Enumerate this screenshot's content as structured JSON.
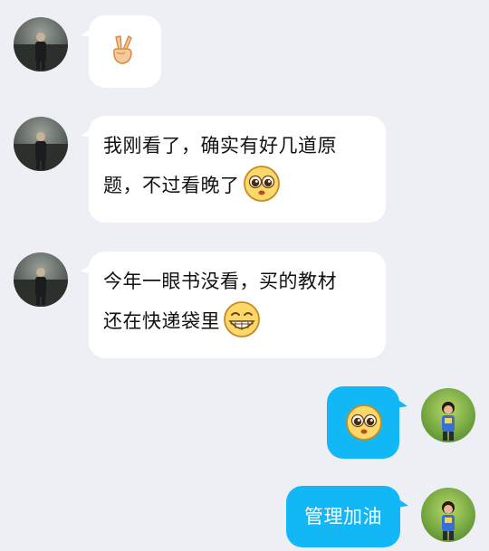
{
  "conversation": {
    "messages": [
      {
        "side": "left",
        "type": "emoji",
        "emoji": "victory-hand-icon"
      },
      {
        "side": "left",
        "type": "text",
        "line1": "我刚看了，确实有好几道原",
        "line2": "题，不过看晚了",
        "emoji": "pleading-face-icon"
      },
      {
        "side": "left",
        "type": "text",
        "line1": "今年一眼书没看，买的教材",
        "line2": "还在快递袋里",
        "emoji": "grinning-face-icon"
      },
      {
        "side": "right",
        "type": "emoji",
        "emoji": "pleading-face-icon"
      },
      {
        "side": "right",
        "type": "text",
        "text": "管理加油"
      }
    ]
  },
  "colors": {
    "background": "#eeeff4",
    "incoming_bubble": "#ffffff",
    "outgoing_bubble": "#12b7f5"
  }
}
